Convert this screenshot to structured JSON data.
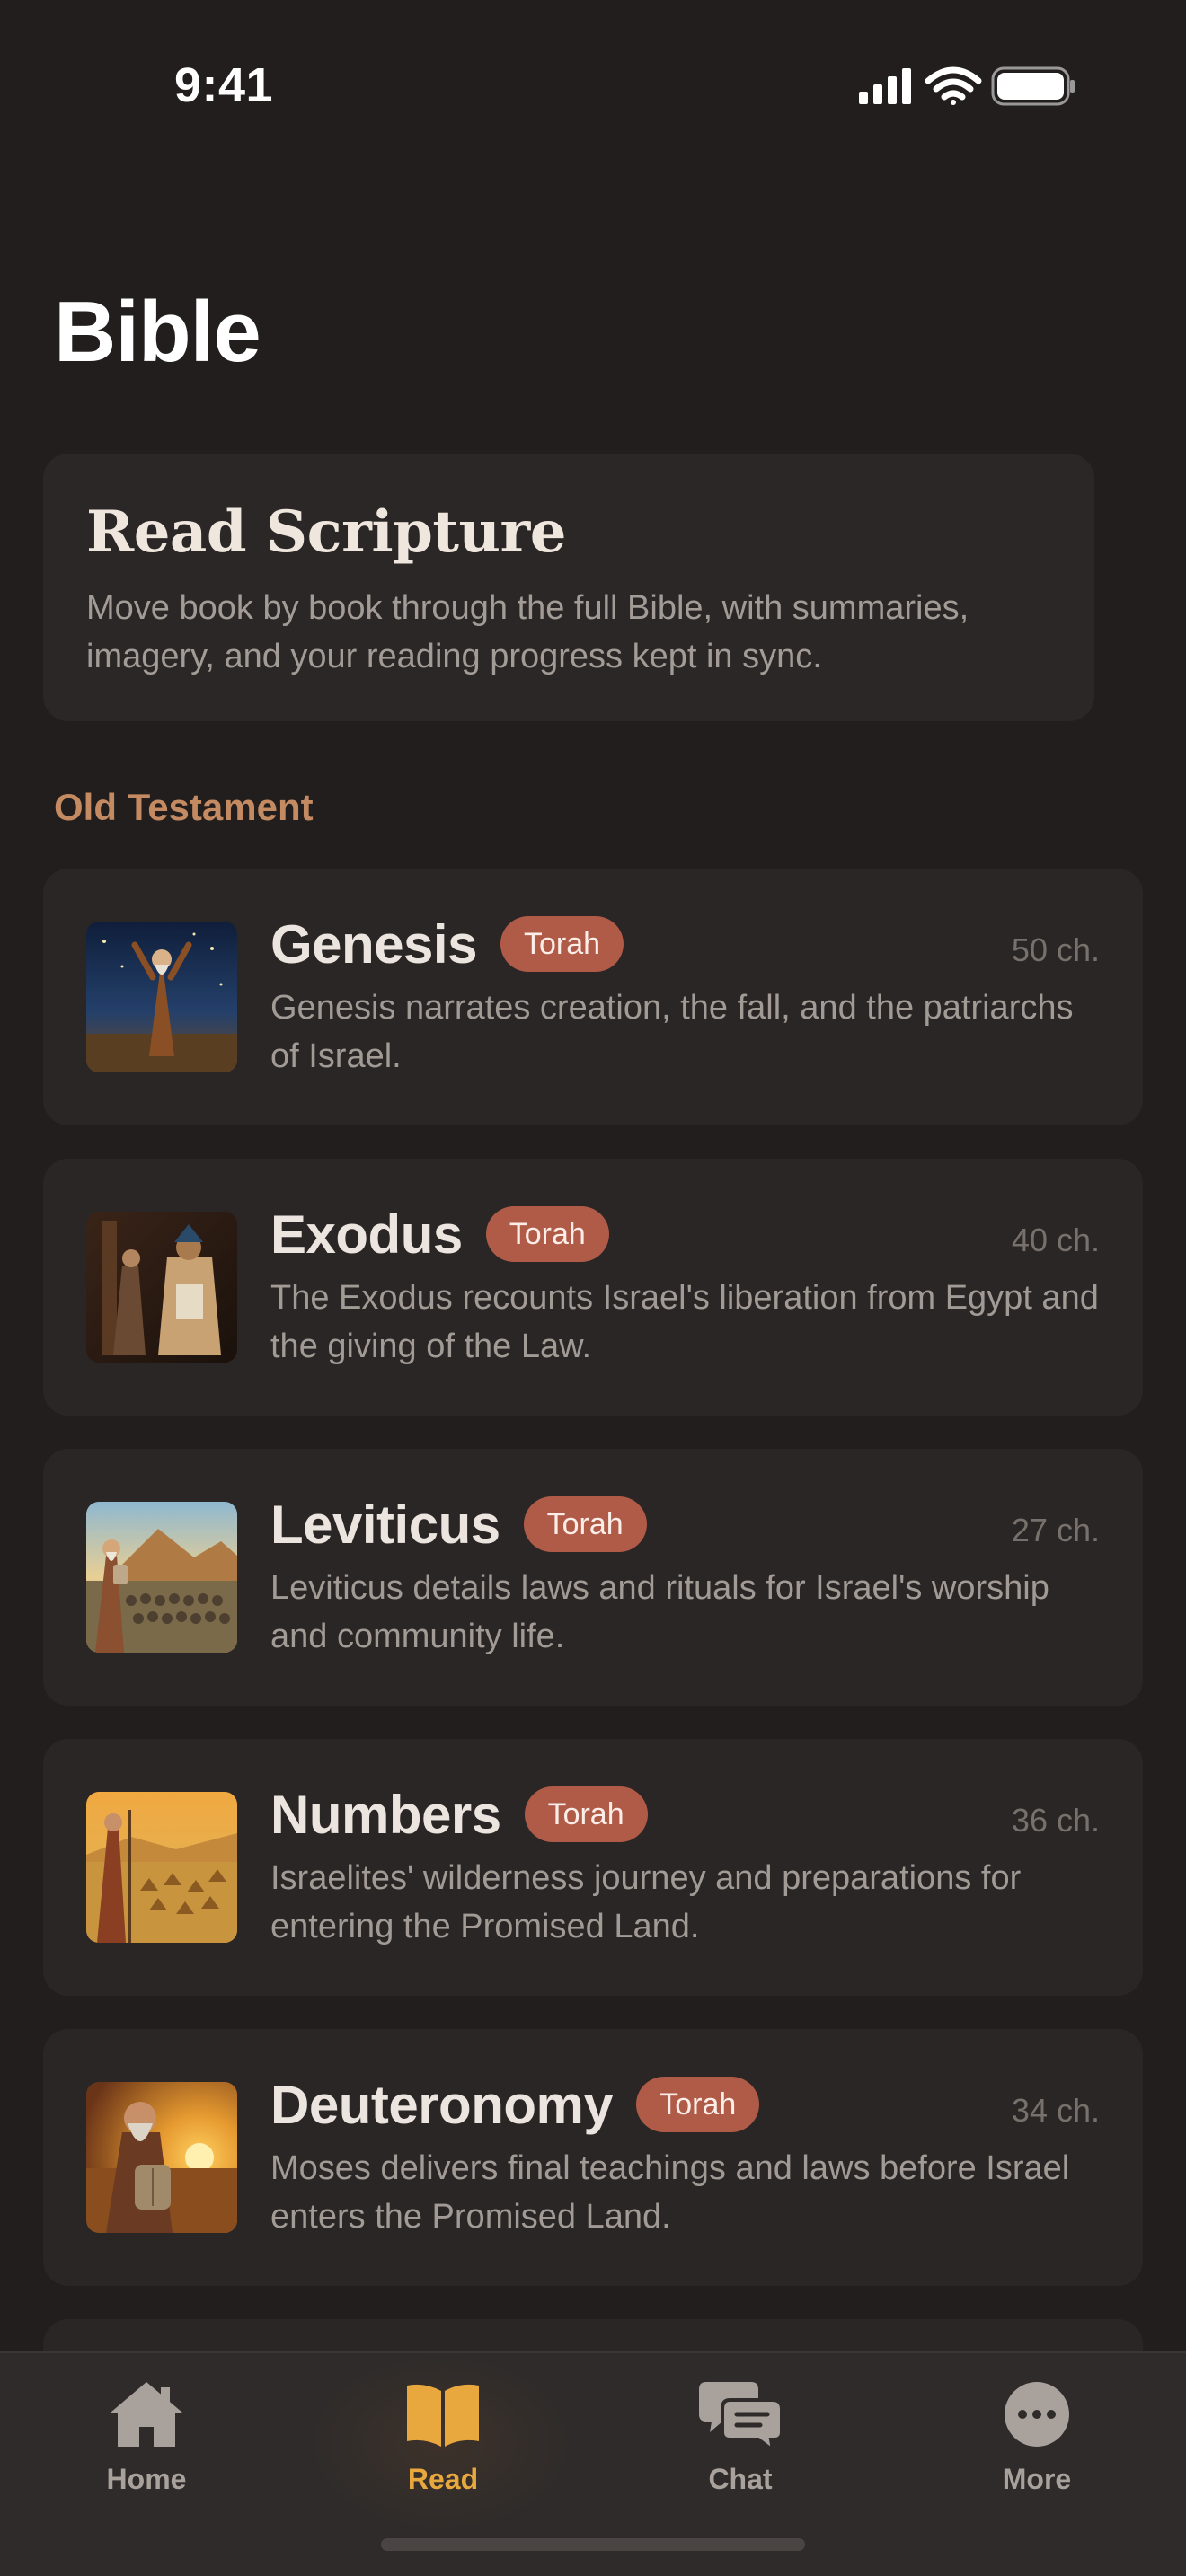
{
  "status_bar": {
    "time": "9:41"
  },
  "page": {
    "title": "Bible"
  },
  "intro": {
    "title": "Read Scripture",
    "description": "Move book by book through the full Bible, with summaries, imagery, and your reading progress kept in sync."
  },
  "section": {
    "label": "Old Testament"
  },
  "books": [
    {
      "name": "Genesis",
      "badge": "Torah",
      "chapters": "50 ch.",
      "description": "Genesis narrates creation, the fall, and the patriarchs of Israel.",
      "image": "moses-night-sky-icon"
    },
    {
      "name": "Exodus",
      "badge": "Torah",
      "chapters": "40 ch.",
      "description": "The Exodus recounts Israel's liberation from Egypt and the giving of the Law.",
      "image": "pharaoh-throne-icon"
    },
    {
      "name": "Leviticus",
      "badge": "Torah",
      "chapters": "27 ch.",
      "description": "Leviticus details laws and rituals for Israel's worship and community life.",
      "image": "moses-crowd-icon"
    },
    {
      "name": "Numbers",
      "badge": "Torah",
      "chapters": "36 ch.",
      "description": "Israelites' wilderness journey and preparations for entering the Promised Land.",
      "image": "wilderness-camp-icon"
    },
    {
      "name": "Deuteronomy",
      "badge": "Torah",
      "chapters": "34 ch.",
      "description": "Moses delivers final teachings and laws before Israel enters the Promised Land.",
      "image": "moses-tablets-sunset-icon"
    }
  ],
  "tab_bar": {
    "items": [
      {
        "label": "Home",
        "icon": "house-icon",
        "active": false
      },
      {
        "label": "Read",
        "icon": "open-book-icon",
        "active": true
      },
      {
        "label": "Chat",
        "icon": "chat-bubbles-icon",
        "active": false
      },
      {
        "label": "More",
        "icon": "ellipsis-circle-icon",
        "active": false
      }
    ]
  },
  "colors": {
    "background": "#211e1d",
    "card": "#2a2625",
    "badge": "#b05a48",
    "section_accent": "#c48a62",
    "active_tab": "#e8a83e"
  }
}
